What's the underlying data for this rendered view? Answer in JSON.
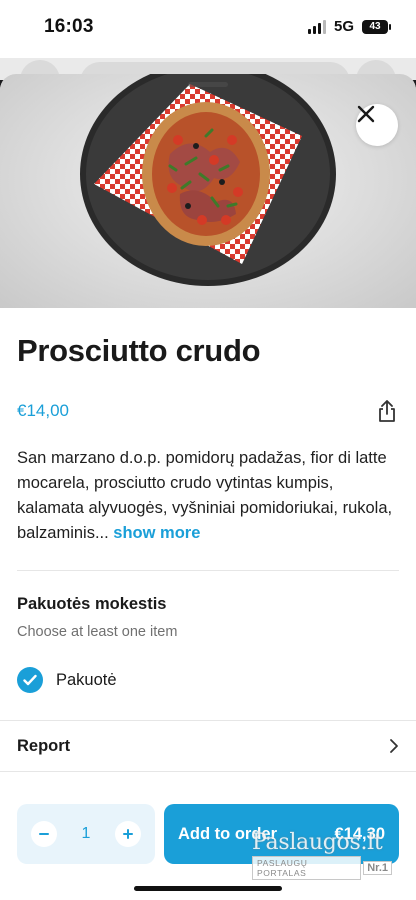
{
  "status_bar": {
    "time": "16:03",
    "network": "5G",
    "battery": "43"
  },
  "product": {
    "name": "Prosciutto crudo",
    "price": "€14,00",
    "description": "San marzano d.o.p. pomidorų padažas, fior di latte mocarela, prosciutto crudo vytintas kumpis, kalamata alyvuogės, vyšniniai pomidoriukai, rukola, balzaminis...",
    "show_more_label": "show more",
    "image_icon": "pizza-photo"
  },
  "options_section": {
    "title": "Pakuotės mokestis",
    "subtitle": "Choose at least one item",
    "items": [
      {
        "label": "Pakuotė",
        "checked": true
      }
    ]
  },
  "report": {
    "label": "Report"
  },
  "order_bar": {
    "quantity": "1",
    "button_label": "Add to order",
    "total": "€14,30"
  },
  "watermark": {
    "main": "Paslaugos.lt",
    "tagline": "PASLAUGŲ PORTALAS",
    "badge": "Nr.1"
  },
  "colors": {
    "accent": "#1a9fd8",
    "stepper_bg": "#e8f4fb"
  }
}
